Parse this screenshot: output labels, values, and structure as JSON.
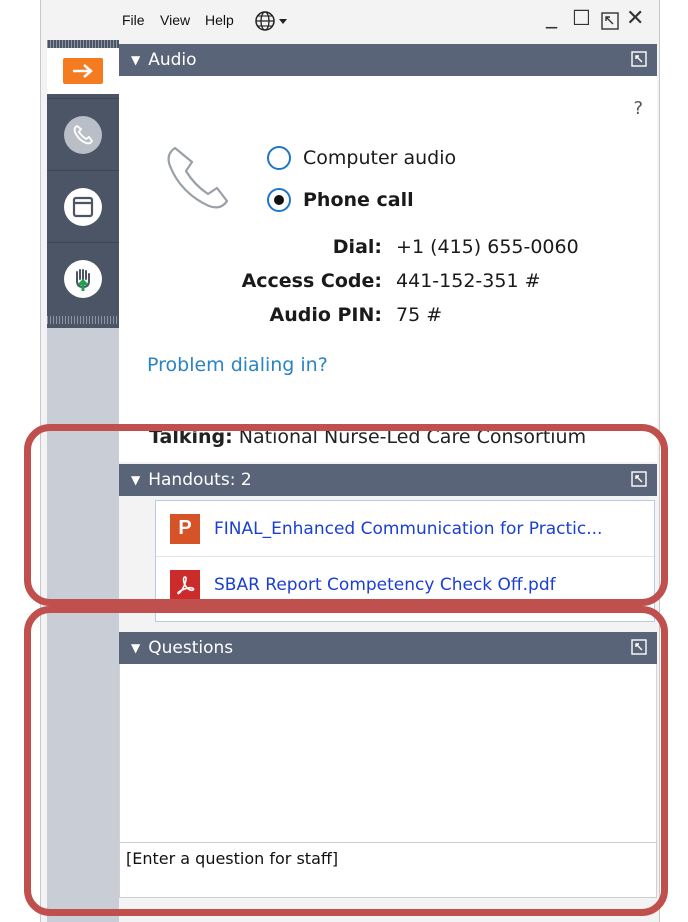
{
  "menu": {
    "file": "File",
    "view": "View",
    "help": "Help",
    "language_icon": "globe-icon"
  },
  "window_controls": {
    "minimize": "_",
    "maximize": "☐",
    "restore_icon": "restore-icon",
    "close": "✕"
  },
  "rail": {
    "items": [
      "collapse-arrow-icon",
      "phone-icon",
      "panel-icon",
      "raise-hand-icon"
    ],
    "accent_color": "#f47b20"
  },
  "audio": {
    "header": "Audio",
    "help": "?",
    "options": [
      {
        "label": "Computer audio",
        "selected": false
      },
      {
        "label": "Phone call",
        "selected": true
      }
    ],
    "dial_label": "Dial:",
    "dial_value": "+1 (415) 655-0060",
    "access_label": "Access Code:",
    "access_value": "441-152-351 #",
    "pin_label": "Audio PIN:",
    "pin_value": "75 #",
    "problem_link": "Problem dialing in?",
    "talking_label": "Talking:",
    "talking_value": "National Nurse-Led Care Consortium"
  },
  "handouts": {
    "header": "Handouts: 2",
    "files": [
      {
        "type": "P",
        "name": "FINAL_Enhanced Communication for Practic...",
        "color": "#d65227"
      },
      {
        "type": "pdf",
        "name": "SBAR Report Competency Check Off.pdf",
        "color": "#cc2b2b"
      }
    ]
  },
  "questions": {
    "header": "Questions",
    "input_placeholder": "[Enter a question for staff]"
  },
  "colors": {
    "panel_header": "#5a6478",
    "link": "#2a84c4",
    "annotation": "#c0504d"
  }
}
